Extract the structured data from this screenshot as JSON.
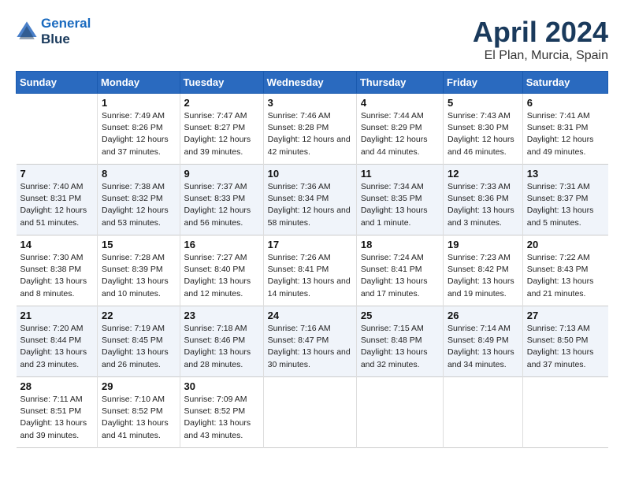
{
  "header": {
    "logo_line1": "General",
    "logo_line2": "Blue",
    "title": "April 2024",
    "location": "El Plan, Murcia, Spain"
  },
  "weekdays": [
    "Sunday",
    "Monday",
    "Tuesday",
    "Wednesday",
    "Thursday",
    "Friday",
    "Saturday"
  ],
  "weeks": [
    [
      {
        "day": "",
        "sunrise": "",
        "sunset": "",
        "daylight": ""
      },
      {
        "day": "1",
        "sunrise": "Sunrise: 7:49 AM",
        "sunset": "Sunset: 8:26 PM",
        "daylight": "Daylight: 12 hours and 37 minutes."
      },
      {
        "day": "2",
        "sunrise": "Sunrise: 7:47 AM",
        "sunset": "Sunset: 8:27 PM",
        "daylight": "Daylight: 12 hours and 39 minutes."
      },
      {
        "day": "3",
        "sunrise": "Sunrise: 7:46 AM",
        "sunset": "Sunset: 8:28 PM",
        "daylight": "Daylight: 12 hours and 42 minutes."
      },
      {
        "day": "4",
        "sunrise": "Sunrise: 7:44 AM",
        "sunset": "Sunset: 8:29 PM",
        "daylight": "Daylight: 12 hours and 44 minutes."
      },
      {
        "day": "5",
        "sunrise": "Sunrise: 7:43 AM",
        "sunset": "Sunset: 8:30 PM",
        "daylight": "Daylight: 12 hours and 46 minutes."
      },
      {
        "day": "6",
        "sunrise": "Sunrise: 7:41 AM",
        "sunset": "Sunset: 8:31 PM",
        "daylight": "Daylight: 12 hours and 49 minutes."
      }
    ],
    [
      {
        "day": "7",
        "sunrise": "Sunrise: 7:40 AM",
        "sunset": "Sunset: 8:31 PM",
        "daylight": "Daylight: 12 hours and 51 minutes."
      },
      {
        "day": "8",
        "sunrise": "Sunrise: 7:38 AM",
        "sunset": "Sunset: 8:32 PM",
        "daylight": "Daylight: 12 hours and 53 minutes."
      },
      {
        "day": "9",
        "sunrise": "Sunrise: 7:37 AM",
        "sunset": "Sunset: 8:33 PM",
        "daylight": "Daylight: 12 hours and 56 minutes."
      },
      {
        "day": "10",
        "sunrise": "Sunrise: 7:36 AM",
        "sunset": "Sunset: 8:34 PM",
        "daylight": "Daylight: 12 hours and 58 minutes."
      },
      {
        "day": "11",
        "sunrise": "Sunrise: 7:34 AM",
        "sunset": "Sunset: 8:35 PM",
        "daylight": "Daylight: 13 hours and 1 minute."
      },
      {
        "day": "12",
        "sunrise": "Sunrise: 7:33 AM",
        "sunset": "Sunset: 8:36 PM",
        "daylight": "Daylight: 13 hours and 3 minutes."
      },
      {
        "day": "13",
        "sunrise": "Sunrise: 7:31 AM",
        "sunset": "Sunset: 8:37 PM",
        "daylight": "Daylight: 13 hours and 5 minutes."
      }
    ],
    [
      {
        "day": "14",
        "sunrise": "Sunrise: 7:30 AM",
        "sunset": "Sunset: 8:38 PM",
        "daylight": "Daylight: 13 hours and 8 minutes."
      },
      {
        "day": "15",
        "sunrise": "Sunrise: 7:28 AM",
        "sunset": "Sunset: 8:39 PM",
        "daylight": "Daylight: 13 hours and 10 minutes."
      },
      {
        "day": "16",
        "sunrise": "Sunrise: 7:27 AM",
        "sunset": "Sunset: 8:40 PM",
        "daylight": "Daylight: 13 hours and 12 minutes."
      },
      {
        "day": "17",
        "sunrise": "Sunrise: 7:26 AM",
        "sunset": "Sunset: 8:41 PM",
        "daylight": "Daylight: 13 hours and 14 minutes."
      },
      {
        "day": "18",
        "sunrise": "Sunrise: 7:24 AM",
        "sunset": "Sunset: 8:41 PM",
        "daylight": "Daylight: 13 hours and 17 minutes."
      },
      {
        "day": "19",
        "sunrise": "Sunrise: 7:23 AM",
        "sunset": "Sunset: 8:42 PM",
        "daylight": "Daylight: 13 hours and 19 minutes."
      },
      {
        "day": "20",
        "sunrise": "Sunrise: 7:22 AM",
        "sunset": "Sunset: 8:43 PM",
        "daylight": "Daylight: 13 hours and 21 minutes."
      }
    ],
    [
      {
        "day": "21",
        "sunrise": "Sunrise: 7:20 AM",
        "sunset": "Sunset: 8:44 PM",
        "daylight": "Daylight: 13 hours and 23 minutes."
      },
      {
        "day": "22",
        "sunrise": "Sunrise: 7:19 AM",
        "sunset": "Sunset: 8:45 PM",
        "daylight": "Daylight: 13 hours and 26 minutes."
      },
      {
        "day": "23",
        "sunrise": "Sunrise: 7:18 AM",
        "sunset": "Sunset: 8:46 PM",
        "daylight": "Daylight: 13 hours and 28 minutes."
      },
      {
        "day": "24",
        "sunrise": "Sunrise: 7:16 AM",
        "sunset": "Sunset: 8:47 PM",
        "daylight": "Daylight: 13 hours and 30 minutes."
      },
      {
        "day": "25",
        "sunrise": "Sunrise: 7:15 AM",
        "sunset": "Sunset: 8:48 PM",
        "daylight": "Daylight: 13 hours and 32 minutes."
      },
      {
        "day": "26",
        "sunrise": "Sunrise: 7:14 AM",
        "sunset": "Sunset: 8:49 PM",
        "daylight": "Daylight: 13 hours and 34 minutes."
      },
      {
        "day": "27",
        "sunrise": "Sunrise: 7:13 AM",
        "sunset": "Sunset: 8:50 PM",
        "daylight": "Daylight: 13 hours and 37 minutes."
      }
    ],
    [
      {
        "day": "28",
        "sunrise": "Sunrise: 7:11 AM",
        "sunset": "Sunset: 8:51 PM",
        "daylight": "Daylight: 13 hours and 39 minutes."
      },
      {
        "day": "29",
        "sunrise": "Sunrise: 7:10 AM",
        "sunset": "Sunset: 8:52 PM",
        "daylight": "Daylight: 13 hours and 41 minutes."
      },
      {
        "day": "30",
        "sunrise": "Sunrise: 7:09 AM",
        "sunset": "Sunset: 8:52 PM",
        "daylight": "Daylight: 13 hours and 43 minutes."
      },
      {
        "day": "",
        "sunrise": "",
        "sunset": "",
        "daylight": ""
      },
      {
        "day": "",
        "sunrise": "",
        "sunset": "",
        "daylight": ""
      },
      {
        "day": "",
        "sunrise": "",
        "sunset": "",
        "daylight": ""
      },
      {
        "day": "",
        "sunrise": "",
        "sunset": "",
        "daylight": ""
      }
    ]
  ]
}
